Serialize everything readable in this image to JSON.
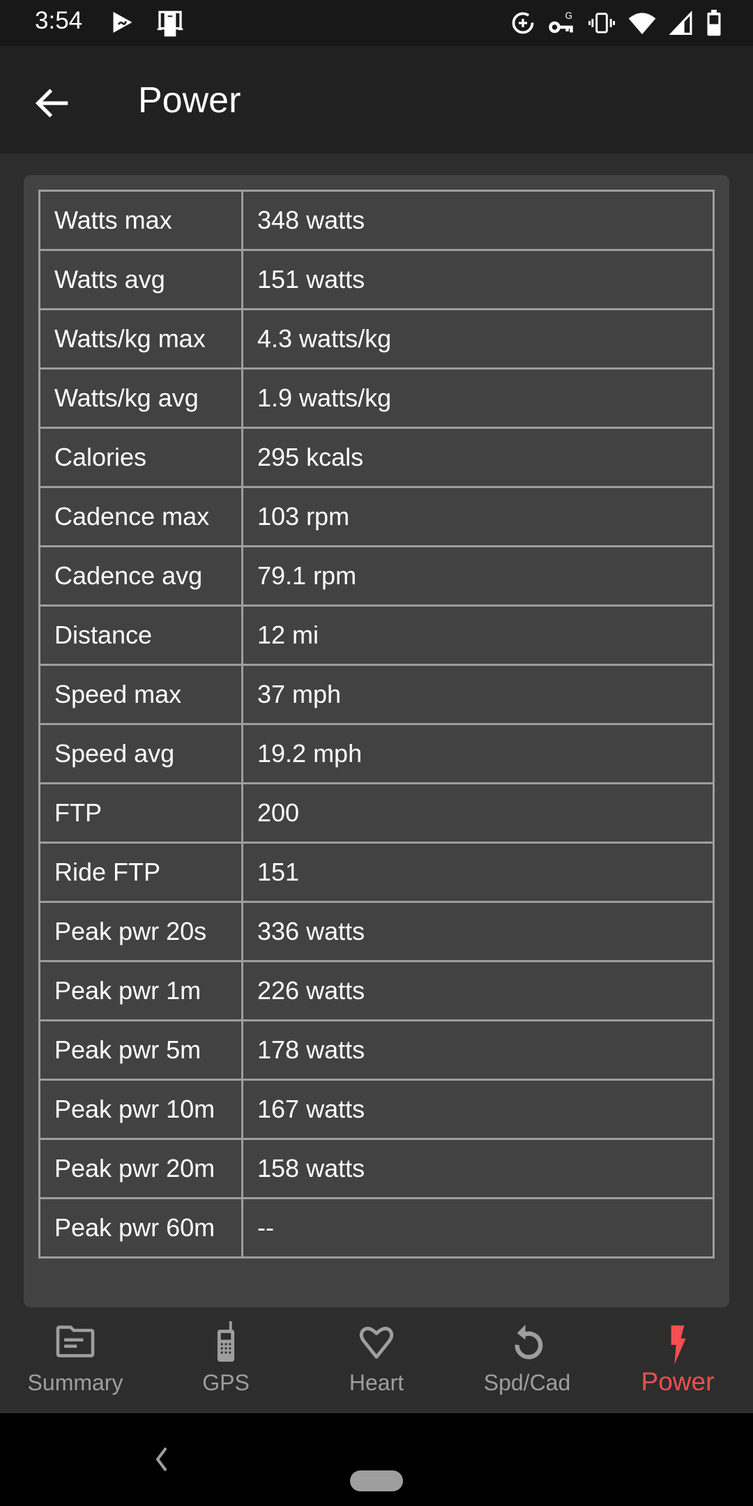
{
  "status_bar": {
    "time": "3:54",
    "left_icons": [
      "media-player-icon",
      "device-icon"
    ],
    "right_icons": [
      "data-saver-icon",
      "vpn-key-icon",
      "vibrate-icon",
      "wifi-icon",
      "cell-signal-icon",
      "battery-icon"
    ]
  },
  "app_bar": {
    "back_icon": "arrow-back-icon",
    "title": "Power"
  },
  "stats": {
    "rows": [
      {
        "label": "Watts max",
        "value": "348 watts"
      },
      {
        "label": "Watts avg",
        "value": "151 watts"
      },
      {
        "label": "Watts/kg max",
        "value": "4.3 watts/kg"
      },
      {
        "label": "Watts/kg avg",
        "value": "1.9 watts/kg"
      },
      {
        "label": "Calories",
        "value": "295 kcals"
      },
      {
        "label": "Cadence max",
        "value": "103 rpm"
      },
      {
        "label": "Cadence avg",
        "value": "79.1 rpm"
      },
      {
        "label": "Distance",
        "value": "12 mi"
      },
      {
        "label": "Speed max",
        "value": "37 mph"
      },
      {
        "label": "Speed avg",
        "value": "19.2 mph"
      },
      {
        "label": "FTP",
        "value": "200"
      },
      {
        "label": "Ride FTP",
        "value": "151"
      },
      {
        "label": "Peak pwr 20s",
        "value": "336 watts"
      },
      {
        "label": "Peak pwr 1m",
        "value": "226 watts"
      },
      {
        "label": "Peak pwr 5m",
        "value": "178 watts"
      },
      {
        "label": "Peak pwr 10m",
        "value": "167 watts"
      },
      {
        "label": "Peak pwr 20m",
        "value": "158 watts"
      },
      {
        "label": "Peak pwr 60m",
        "value": "--"
      }
    ]
  },
  "bottom_nav": {
    "active_color": "#f44f4f",
    "inactive_color": "#9e9e9e",
    "items": [
      {
        "label": "Summary",
        "icon": "folder-summary-icon",
        "active": false
      },
      {
        "label": "GPS",
        "icon": "phone-gps-icon",
        "active": false
      },
      {
        "label": "Heart",
        "icon": "heart-icon",
        "active": false
      },
      {
        "label": "Spd/Cad",
        "icon": "rotate-icon",
        "active": false
      },
      {
        "label": "Power",
        "icon": "lightning-bolt-icon",
        "active": true
      }
    ]
  }
}
